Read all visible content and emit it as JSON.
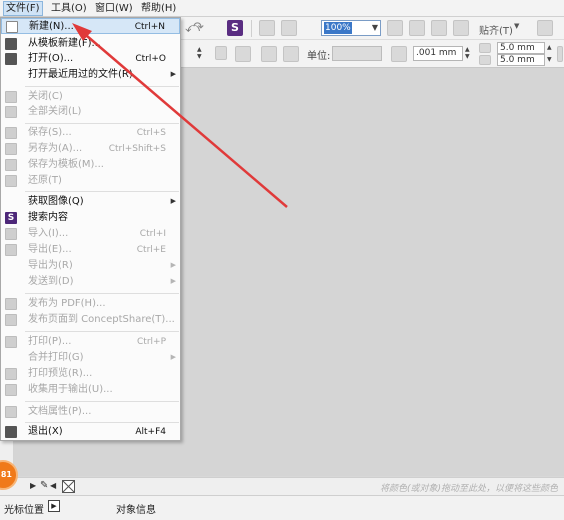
{
  "menubar": {
    "file": "文件(F)",
    "tools": "工具(O)",
    "window": "窗口(W)",
    "help": "帮助(H)"
  },
  "toolbar": {
    "zoom": "100%",
    "snap_label": "贴齐(T)",
    "unit_label": "单位:",
    "nudge_value": ".001 mm",
    "dup_x": "5.0 mm",
    "dup_y": "5.0 mm"
  },
  "file_menu": {
    "new": {
      "label": "新建(N)...",
      "shortcut": "Ctrl+N"
    },
    "new_from_template": {
      "label": "从模板新建(F)..."
    },
    "open": {
      "label": "打开(O)...",
      "shortcut": "Ctrl+O"
    },
    "open_recent": {
      "label": "打开最近用过的文件(R)"
    },
    "close": {
      "label": "关闭(C)"
    },
    "close_all": {
      "label": "全部关闭(L)"
    },
    "save": {
      "label": "保存(S)...",
      "shortcut": "Ctrl+S"
    },
    "save_as": {
      "label": "另存为(A)...",
      "shortcut": "Ctrl+Shift+S"
    },
    "save_as_template": {
      "label": "保存为模板(M)..."
    },
    "revert": {
      "label": "还原(T)"
    },
    "acquire_image": {
      "label": "获取图像(Q)"
    },
    "search_content": {
      "label": "搜索内容"
    },
    "import": {
      "label": "导入(I)...",
      "shortcut": "Ctrl+I"
    },
    "export": {
      "label": "导出(E)...",
      "shortcut": "Ctrl+E"
    },
    "export_for": {
      "label": "导出为(R)"
    },
    "send_to": {
      "label": "发送到(D)"
    },
    "publish_pdf": {
      "label": "发布为 PDF(H)..."
    },
    "publish_conceptshare": {
      "label": "发布页面到 ConceptShare(T)..."
    },
    "print": {
      "label": "打印(P)...",
      "shortcut": "Ctrl+P"
    },
    "print_merge": {
      "label": "合并打印(G)"
    },
    "print_preview": {
      "label": "打印预览(R)..."
    },
    "collect_for_output": {
      "label": "收集用于输出(U)..."
    },
    "doc_properties": {
      "label": "文档属性(P)..."
    },
    "exit": {
      "label": "退出(X)",
      "shortcut": "Alt+F4"
    }
  },
  "palette_bar": {
    "hint": "将颜色(或对象)拖动至此处，以便将这些颜色"
  },
  "status_bar": {
    "cursor_position": "光标位置",
    "object_info": "对象信息"
  },
  "badge": "81",
  "colors": {
    "arrow": "#e03a3a",
    "highlight": "#d6e7f7",
    "brand_purple": "#4d2779",
    "badge_orange": "#f07a1a"
  }
}
